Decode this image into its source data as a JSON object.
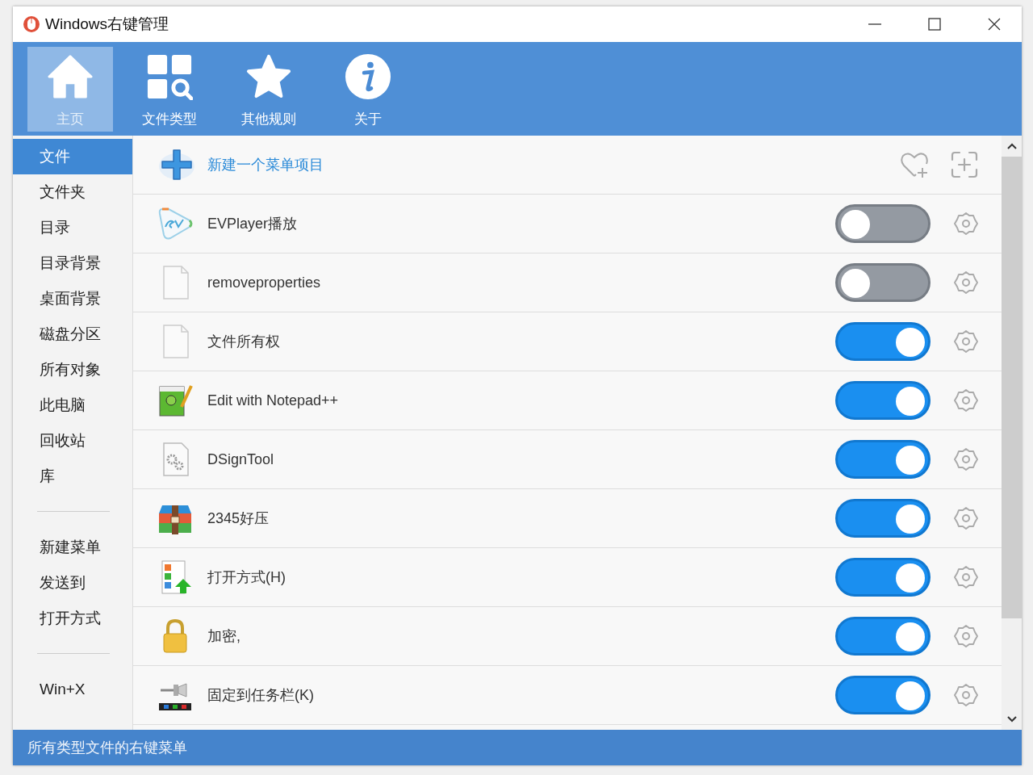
{
  "window": {
    "title": "Windows右键管理"
  },
  "toolbar": [
    {
      "label": "主页",
      "kind": "home",
      "selected": true
    },
    {
      "label": "文件类型",
      "kind": "types",
      "selected": false
    },
    {
      "label": "其他规则",
      "kind": "star",
      "selected": false
    },
    {
      "label": "关于",
      "kind": "info",
      "selected": false
    }
  ],
  "sidebar": {
    "sections": [
      {
        "items": [
          {
            "label": "文件",
            "selected": true
          },
          {
            "label": "文件夹",
            "selected": false
          },
          {
            "label": "目录",
            "selected": false
          },
          {
            "label": "目录背景",
            "selected": false
          },
          {
            "label": "桌面背景",
            "selected": false
          },
          {
            "label": "磁盘分区",
            "selected": false
          },
          {
            "label": "所有对象",
            "selected": false
          },
          {
            "label": "此电脑",
            "selected": false
          },
          {
            "label": "回收站",
            "selected": false
          },
          {
            "label": "库",
            "selected": false
          }
        ]
      },
      {
        "items": [
          {
            "label": "新建菜单",
            "selected": false
          },
          {
            "label": "发送到",
            "selected": false
          },
          {
            "label": "打开方式",
            "selected": false
          }
        ]
      },
      {
        "items": [
          {
            "label": "Win+X",
            "selected": false
          }
        ]
      }
    ]
  },
  "new_item": {
    "label": "新建一个菜单项目"
  },
  "items": [
    {
      "name": "EVPlayer播放",
      "kind": "evplayer",
      "on": false
    },
    {
      "name": "removeproperties",
      "kind": "file",
      "on": false
    },
    {
      "name": "文件所有权",
      "kind": "file",
      "on": true
    },
    {
      "name": "Edit with Notepad++",
      "kind": "notepad",
      "on": true
    },
    {
      "name": "DSignTool",
      "kind": "gearfile",
      "on": true
    },
    {
      "name": "2345好压",
      "kind": "archive",
      "on": true
    },
    {
      "name": "打开方式(H)",
      "kind": "openwith",
      "on": true
    },
    {
      "name": "加密,",
      "kind": "lock",
      "on": true
    },
    {
      "name": "固定到任务栏(K)",
      "kind": "pin",
      "on": true
    }
  ],
  "status_bar": "所有类型文件的右键菜单"
}
